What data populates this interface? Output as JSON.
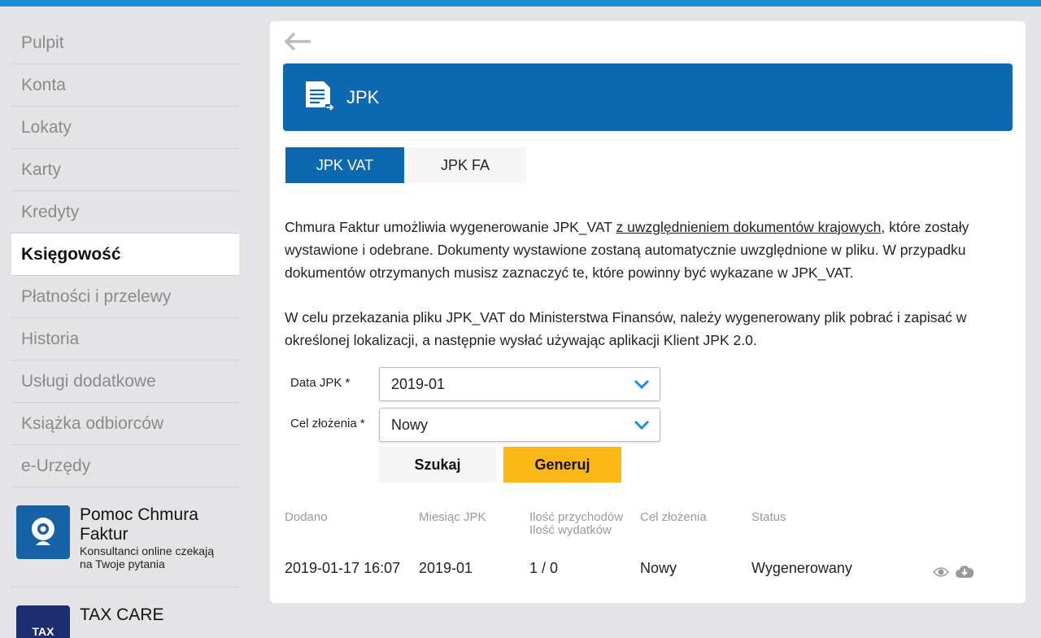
{
  "sidebar": {
    "items": [
      "Pulpit",
      "Konta",
      "Lokaty",
      "Karty",
      "Kredyty",
      "Księgowość",
      "Płatności i przelewy",
      "Historia",
      "Usługi dodatkowe",
      "Książka odbiorców",
      "e-Urzędy"
    ],
    "promo": {
      "title": "Pomoc Chmura Faktur",
      "line1": "Konsultanci online czekają",
      "line2": "na Twoje pytania"
    },
    "promo2": {
      "title": "TAX CARE",
      "logo": "TAX"
    }
  },
  "header": {
    "title": "JPK"
  },
  "tabs": [
    "JPK VAT",
    "JPK FA"
  ],
  "text": {
    "p1a": "Chmura Faktur umożliwia wygenerowanie JPK_VAT ",
    "p1link": "z uwzględnieniem dokumentów krajowych",
    "p1b": ", które zostały wystawione i odebrane. Dokumenty wystawione zostaną automatycznie uwzględnione w pliku. W przypadku dokumentów otrzymanych musisz zaznaczyć te, które powinny być wykazane w JPK_VAT.",
    "p2": "W celu przekazania pliku JPK_VAT do Ministerstwa Finansów, należy wygenerowany plik pobrać i zapisać w określonej lokalizacji, a następnie wysłać używając aplikacji Klient JPK 2.0."
  },
  "form": {
    "date_label": "Data JPK *",
    "date_value": "2019-01",
    "purpose_label": "Cel złożenia *",
    "purpose_value": "Nowy",
    "search": "Szukaj",
    "generate": "Generuj"
  },
  "table": {
    "headers": [
      "Dodano",
      "Miesiąc JPK",
      "Ilość przychodów",
      "Ilość wydatków",
      "Cel złożenia",
      "Status"
    ],
    "rows": [
      {
        "added": "2019-01-17 16:07",
        "month": "2019-01",
        "counts": "1 / 0",
        "purpose": "Nowy",
        "status": "Wygenerowany"
      }
    ]
  },
  "colors": {
    "brand": "#0c69b0",
    "accent": "#fbb715",
    "topbar": "#1d8ed6"
  }
}
